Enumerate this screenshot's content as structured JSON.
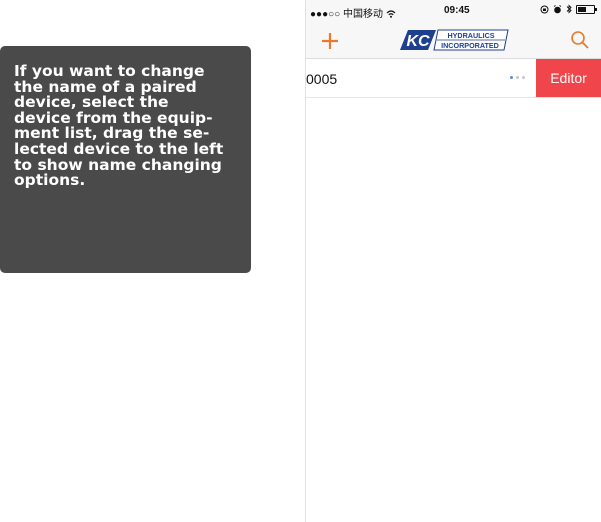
{
  "callout": {
    "text": "If you want to change\nthe name of a paired\ndevice, select the\ndevice from the equip-\nment list, drag the se-\nlected device to the left\nto show name changing\noptions."
  },
  "status_bar": {
    "carrier": "●●●○○ 中国移动",
    "time": "09:45",
    "battery_level": 0.55
  },
  "nav": {
    "add_icon": "plus-icon",
    "search_icon": "search-icon",
    "logo": {
      "mark": "KC",
      "line1": "HYDRAULICS",
      "line2": "INCORPORATED"
    }
  },
  "device_list": {
    "items": [
      {
        "label": "0005",
        "action_label": "Editor"
      }
    ]
  },
  "colors": {
    "accent": "#e9792c",
    "action_red": "#f0454a",
    "callout_bg": "#4a4a4a",
    "logo_blue": "#1f3f8f"
  }
}
